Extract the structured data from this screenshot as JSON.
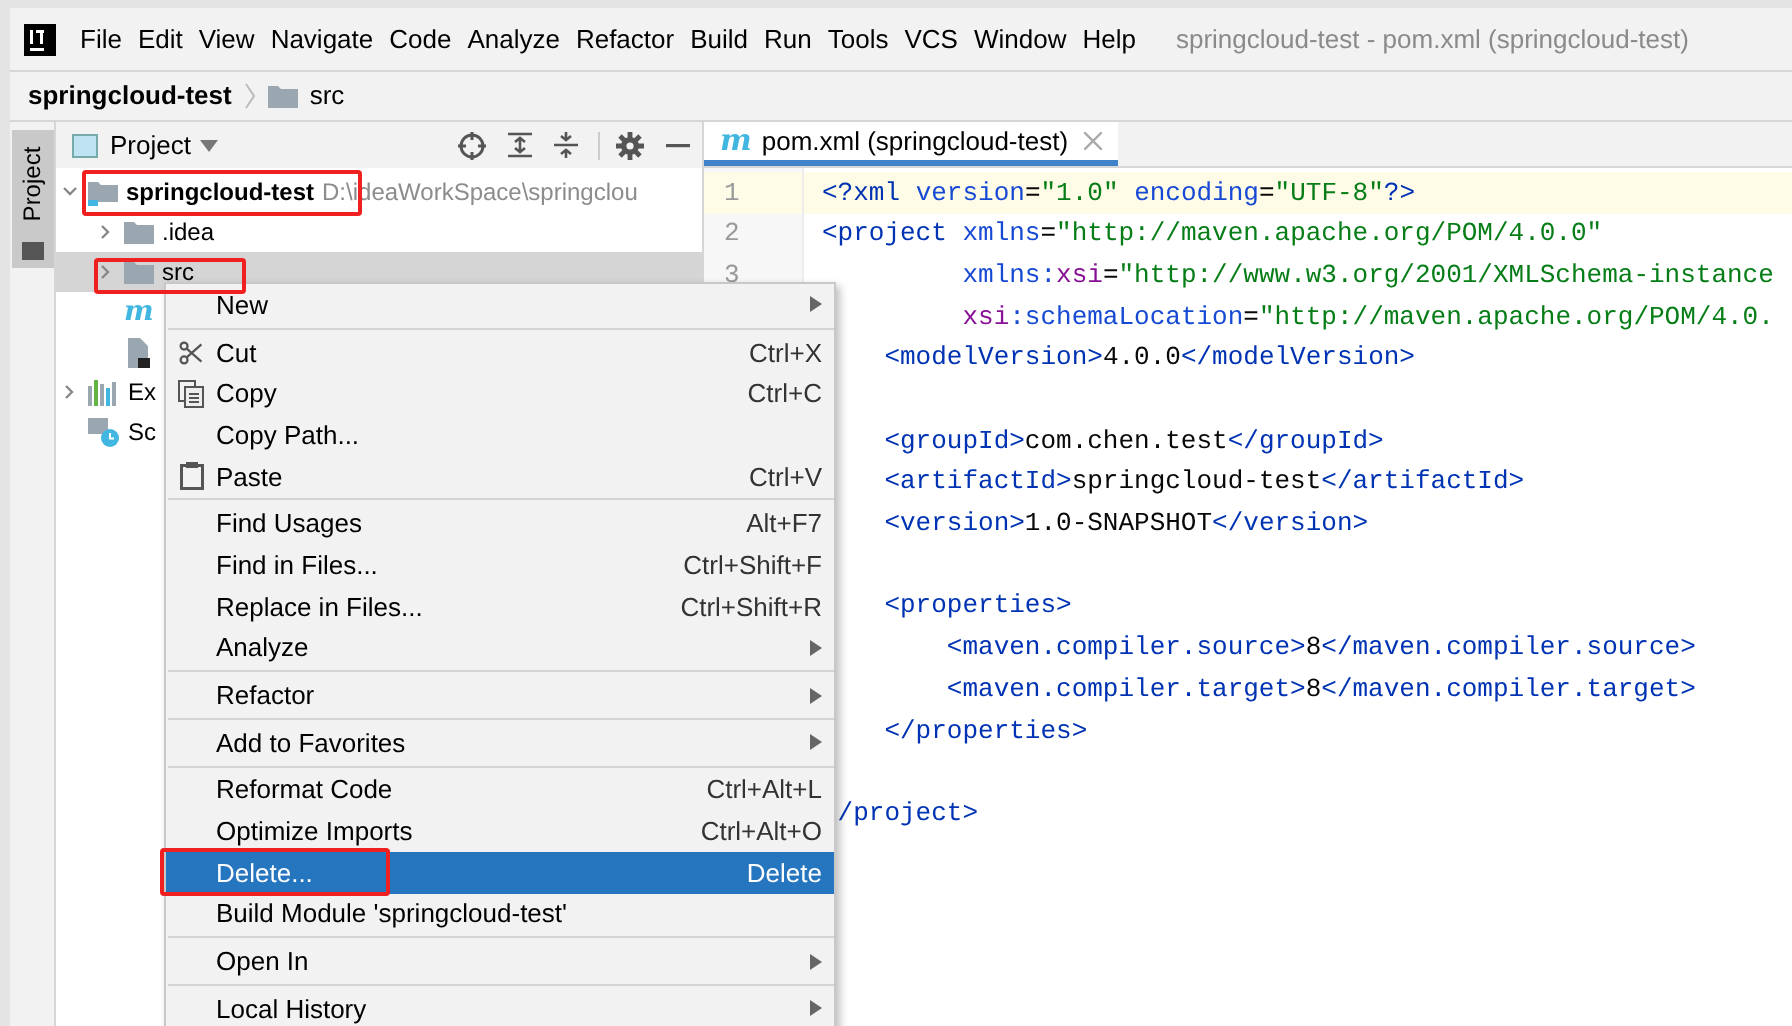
{
  "menu_bar": {
    "items": [
      "File",
      "Edit",
      "View",
      "Navigate",
      "Code",
      "Analyze",
      "Refactor",
      "Build",
      "Run",
      "Tools",
      "VCS",
      "Window",
      "Help"
    ],
    "window_title": "springcloud-test - pom.xml (springcloud-test)"
  },
  "breadcrumb": [
    "springcloud-test",
    "src"
  ],
  "side_stripe": {
    "tabs": [
      {
        "label": "Project",
        "selected": true
      }
    ]
  },
  "project_panel": {
    "title": "Project",
    "tree": [
      {
        "kind": "module",
        "label": "springcloud-test",
        "path": "D:\\ideaWorkSpace\\springclou",
        "expanded": true,
        "selected": false,
        "children": [
          {
            "kind": "folder",
            "label": ".idea",
            "expanded": false,
            "selected": false
          },
          {
            "kind": "folder",
            "label": "src",
            "expanded": false,
            "selected": true
          },
          {
            "kind": "maven",
            "glyph": "m",
            "selected": false
          },
          {
            "kind": "file",
            "selected": false
          }
        ]
      },
      {
        "kind": "libraries",
        "label": "Ex",
        "expanded": false,
        "selected": false
      },
      {
        "kind": "scratches",
        "label": "Sc",
        "selected": false
      }
    ]
  },
  "editor": {
    "tabs": [
      {
        "glyph": "m",
        "label": "pom.xml (springcloud-test)",
        "selected": true
      }
    ],
    "line_numbers": [
      "1",
      "2",
      "3"
    ],
    "lines": [
      {
        "current": true,
        "tokens": [
          {
            "kind": "tag",
            "text": "<?xml"
          },
          {
            "kind": "attr",
            "text": " version"
          },
          {
            "kind": "plain",
            "text": "="
          },
          {
            "kind": "value",
            "text": "\"1.0\""
          },
          {
            "kind": "attr",
            "text": " encoding"
          },
          {
            "kind": "plain",
            "text": "="
          },
          {
            "kind": "value",
            "text": "\"UTF-8\""
          },
          {
            "kind": "tag",
            "text": "?>"
          }
        ]
      },
      {
        "current": false,
        "tokens": [
          {
            "kind": "tag",
            "text": "<project"
          },
          {
            "kind": "attr",
            "text": " xmlns"
          },
          {
            "kind": "plain",
            "text": "="
          },
          {
            "kind": "value",
            "text": "\"http://maven.apache.org/POM/4.0.0\""
          }
        ]
      },
      {
        "current": false,
        "tokens": [
          {
            "kind": "attr",
            "text": "         xmlns:"
          },
          {
            "kind": "ns",
            "text": "xsi"
          },
          {
            "kind": "plain",
            "text": "="
          },
          {
            "kind": "value",
            "text": "\"http://www.w3.org/2001/XMLSchema-instance"
          }
        ]
      },
      {
        "current": false,
        "tokens": [
          {
            "kind": "ns",
            "text": "         xsi"
          },
          {
            "kind": "attr",
            "text": ":schemaLocation"
          },
          {
            "kind": "plain",
            "text": "="
          },
          {
            "kind": "value",
            "text": "\"http://maven.apache.org/POM/4.0."
          }
        ]
      },
      {
        "current": false,
        "tokens": [
          {
            "kind": "tag",
            "text": "    <modelVersion>"
          },
          {
            "kind": "plain",
            "text": "4.0.0"
          },
          {
            "kind": "tag",
            "text": "</modelVersion>"
          }
        ]
      },
      {
        "kind": "blank"
      },
      {
        "current": false,
        "tokens": [
          {
            "kind": "tag",
            "text": "    <groupId>"
          },
          {
            "kind": "plain",
            "text": "com.chen.test"
          },
          {
            "kind": "tag",
            "text": "</groupId>"
          }
        ]
      },
      {
        "current": false,
        "tokens": [
          {
            "kind": "tag",
            "text": "    <artifactId>"
          },
          {
            "kind": "plain",
            "text": "springcloud-test"
          },
          {
            "kind": "tag",
            "text": "</artifactId>"
          }
        ]
      },
      {
        "current": false,
        "tokens": [
          {
            "kind": "tag",
            "text": "    <version>"
          },
          {
            "kind": "plain",
            "text": "1.0-SNAPSHOT"
          },
          {
            "kind": "tag",
            "text": "</version>"
          }
        ]
      },
      {
        "kind": "blank"
      },
      {
        "current": false,
        "tokens": [
          {
            "kind": "tag",
            "text": "    <properties>"
          }
        ]
      },
      {
        "current": false,
        "tokens": [
          {
            "kind": "tag",
            "text": "        <maven.compiler.source>"
          },
          {
            "kind": "plain",
            "text": "8"
          },
          {
            "kind": "tag",
            "text": "</maven.compiler.source>"
          }
        ]
      },
      {
        "current": false,
        "tokens": [
          {
            "kind": "tag",
            "text": "        <maven.compiler.target>"
          },
          {
            "kind": "plain",
            "text": "8"
          },
          {
            "kind": "tag",
            "text": "</maven.compiler.target>"
          }
        ]
      },
      {
        "current": false,
        "tokens": [
          {
            "kind": "tag",
            "text": "    </properties>"
          }
        ]
      },
      {
        "kind": "blank"
      },
      {
        "current": false,
        "tokens": [
          {
            "kind": "tag",
            "text": " /project>"
          }
        ]
      }
    ]
  },
  "context_menu": {
    "items": [
      {
        "kind": "item",
        "label": "New",
        "submenu": true,
        "selected": false
      },
      {
        "kind": "separator"
      },
      {
        "kind": "icon_item",
        "label": "Cut",
        "shortcut": "Ctrl+X",
        "selected": false
      },
      {
        "kind": "icon_item",
        "label": "Copy",
        "shortcut": "Ctrl+C",
        "selected": false
      },
      {
        "kind": "item",
        "label": "Copy Path...",
        "selected": false
      },
      {
        "kind": "icon_item",
        "label": "Paste",
        "shortcut": "Ctrl+V",
        "selected": false
      },
      {
        "kind": "separator"
      },
      {
        "kind": "item",
        "label": "Find Usages",
        "shortcut": "Alt+F7",
        "selected": false
      },
      {
        "kind": "item",
        "label": "Find in Files...",
        "shortcut": "Ctrl+Shift+F",
        "selected": false
      },
      {
        "kind": "item",
        "label": "Replace in Files...",
        "shortcut": "Ctrl+Shift+R",
        "selected": false
      },
      {
        "kind": "item",
        "label": "Analyze",
        "submenu": true,
        "selected": false
      },
      {
        "kind": "separator"
      },
      {
        "kind": "item",
        "label": "Refactor",
        "submenu": true,
        "selected": false
      },
      {
        "kind": "separator"
      },
      {
        "kind": "item",
        "label": "Add to Favorites",
        "submenu": true,
        "selected": false
      },
      {
        "kind": "separator"
      },
      {
        "kind": "item",
        "label": "Reformat Code",
        "shortcut": "Ctrl+Alt+L",
        "selected": false
      },
      {
        "kind": "item",
        "label": "Optimize Imports",
        "shortcut": "Ctrl+Alt+O",
        "selected": false
      },
      {
        "kind": "item",
        "label": "Delete...",
        "shortcut": "Delete",
        "selected": true
      },
      {
        "kind": "item",
        "label": "Build Module 'springcloud-test'",
        "selected": false
      },
      {
        "kind": "separator"
      },
      {
        "kind": "item",
        "label": "Open In",
        "submenu": true,
        "selected": false
      },
      {
        "kind": "separator"
      },
      {
        "kind": "item",
        "label": "Local History",
        "submenu": true,
        "selected": false
      }
    ]
  }
}
